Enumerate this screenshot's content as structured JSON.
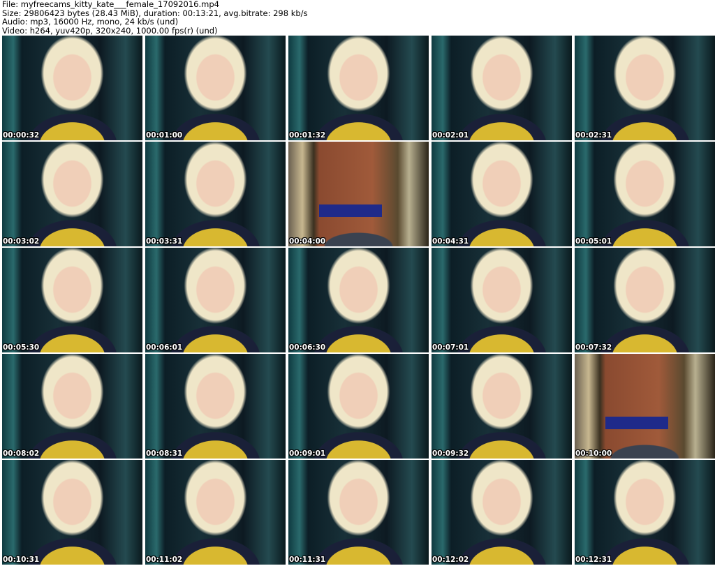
{
  "header": {
    "file": "File: myfreecams_kitty_kate___female_17092016.mp4",
    "size": "Size: 29806423 bytes (28.43 MiB), duration: 00:13:21, avg.bitrate: 298 kb/s",
    "audio": "Audio: mp3, 16000 Hz, mono, 24 kb/s (und)",
    "video": "Video: h264, yuv420p, 320x240, 1000.00 fps(r) (und)"
  },
  "thumbnails": [
    {
      "time": "00:00:32",
      "scene": "person"
    },
    {
      "time": "00:01:00",
      "scene": "person"
    },
    {
      "time": "00:01:32",
      "scene": "person"
    },
    {
      "time": "00:02:01",
      "scene": "person"
    },
    {
      "time": "00:02:31",
      "scene": "person"
    },
    {
      "time": "00:03:02",
      "scene": "person"
    },
    {
      "time": "00:03:31",
      "scene": "person"
    },
    {
      "time": "00:04:00",
      "scene": "room"
    },
    {
      "time": "00:04:31",
      "scene": "person"
    },
    {
      "time": "00:05:01",
      "scene": "person"
    },
    {
      "time": "00:05:30",
      "scene": "person"
    },
    {
      "time": "00:06:01",
      "scene": "person"
    },
    {
      "time": "00:06:30",
      "scene": "person"
    },
    {
      "time": "00:07:01",
      "scene": "person"
    },
    {
      "time": "00:07:32",
      "scene": "person"
    },
    {
      "time": "00:08:02",
      "scene": "person"
    },
    {
      "time": "00:08:31",
      "scene": "person"
    },
    {
      "time": "00:09:01",
      "scene": "person"
    },
    {
      "time": "00:09:32",
      "scene": "person"
    },
    {
      "time": "00:10:00",
      "scene": "room"
    },
    {
      "time": "00:10:31",
      "scene": "person"
    },
    {
      "time": "00:11:02",
      "scene": "person"
    },
    {
      "time": "00:11:31",
      "scene": "person"
    },
    {
      "time": "00:12:02",
      "scene": "person"
    },
    {
      "time": "00:12:31",
      "scene": "person"
    }
  ]
}
